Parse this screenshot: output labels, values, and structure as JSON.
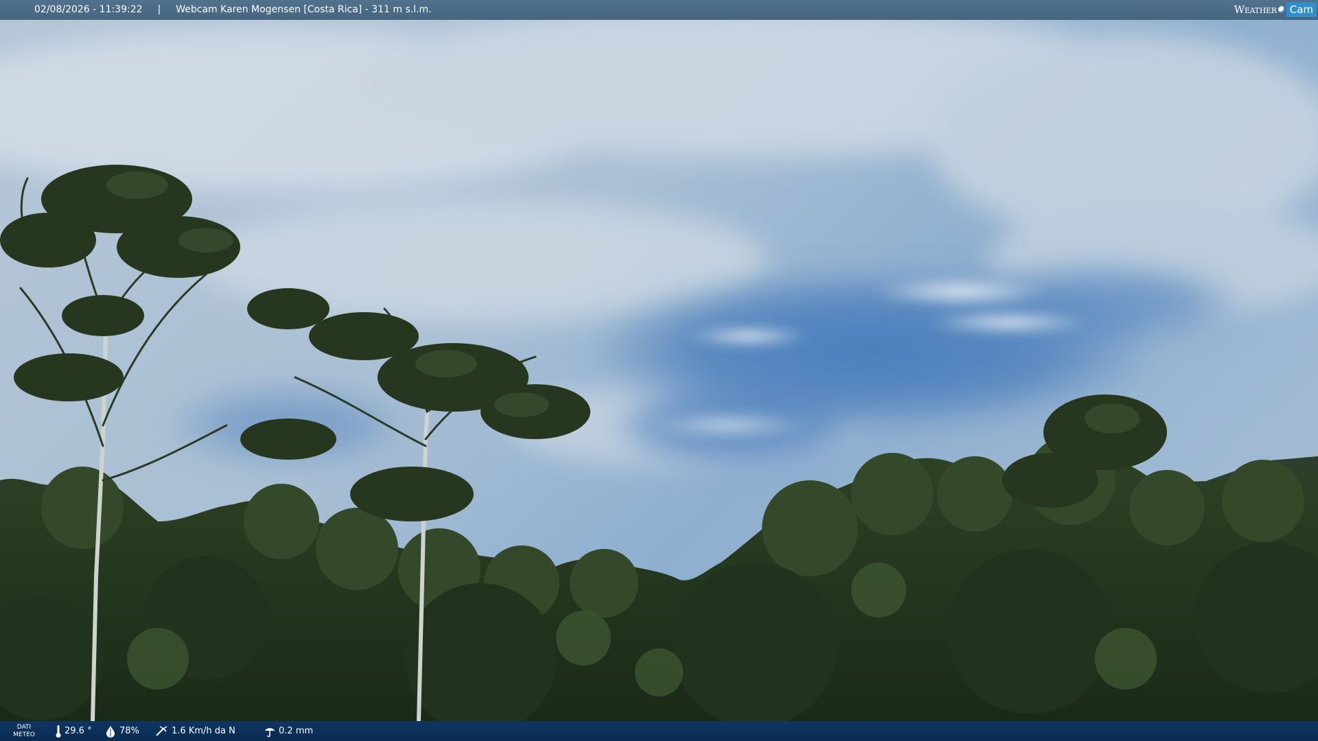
{
  "caption": {
    "datetime": "02/08/2026 - 11:39:22",
    "separator": "|",
    "title": "Webcam Karen Mogensen [Costa Rica]  - 311 m s.l.m."
  },
  "logo": {
    "part1": "Weather",
    "part2": "Cam"
  },
  "weather": {
    "label_line1": "DATI",
    "label_line2": "METEO",
    "temperature": "29.6 °",
    "humidity": "78%",
    "wind": "1.6 Km/h da N",
    "rain": "0.2 mm"
  },
  "icons": [
    "thermometer-icon",
    "humidity-icon",
    "wind-icon",
    "rain-icon"
  ],
  "colors": {
    "top_bar": "#4c6b86",
    "bottom_bar": "#0d3360",
    "sky_blue": "#4f82bd",
    "cloud": "#c8d6e4",
    "foliage": "#27381f"
  }
}
